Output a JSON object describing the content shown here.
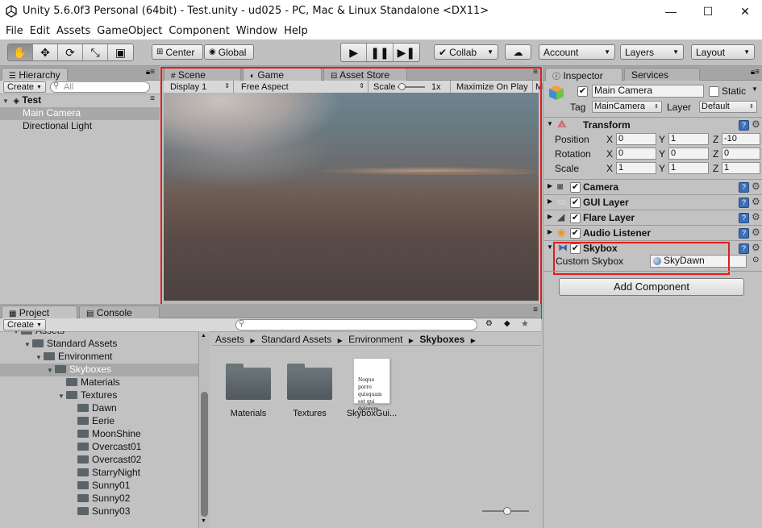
{
  "window": {
    "title": "Unity 5.6.0f3 Personal (64bit) - Test.unity - ud025 - PC, Mac & Linux Standalone <DX11>",
    "minimize": "—",
    "maximize": "☐",
    "close": "✕"
  },
  "menu": [
    "File",
    "Edit",
    "Assets",
    "GameObject",
    "Component",
    "Window",
    "Help"
  ],
  "toolbar": {
    "tools": [
      "hand",
      "move",
      "rotate",
      "scale",
      "rect"
    ],
    "pivot": "Center",
    "space": "Global",
    "collab": "Collab",
    "account": "Account",
    "layers": "Layers",
    "layout": "Layout"
  },
  "hierarchy": {
    "tab": "Hierarchy",
    "create": "Create",
    "search_placeholder": "All",
    "scene": "Test",
    "items": [
      "Main Camera",
      "Directional Light"
    ]
  },
  "center": {
    "tabs": [
      "Scene",
      "Game",
      "Asset Store"
    ],
    "display": "Display 1",
    "aspect": "Free Aspect",
    "scale_label": "Scale",
    "scale_value": "1x",
    "maximize": "Maximize On Play",
    "extra": "M"
  },
  "project": {
    "tabs": [
      "Project",
      "Console"
    ],
    "create": "Create",
    "tree": [
      {
        "label": "Assets",
        "depth": 0,
        "open": true
      },
      {
        "label": "Standard Assets",
        "depth": 1,
        "open": true
      },
      {
        "label": "Environment",
        "depth": 2,
        "open": true
      },
      {
        "label": "Skyboxes",
        "depth": 3,
        "open": true,
        "selected": true
      },
      {
        "label": "Materials",
        "depth": 4
      },
      {
        "label": "Textures",
        "depth": 4,
        "open": true
      },
      {
        "label": "Dawn",
        "depth": 5
      },
      {
        "label": "Eerie",
        "depth": 5
      },
      {
        "label": "MoonShine",
        "depth": 5
      },
      {
        "label": "Overcast01",
        "depth": 5
      },
      {
        "label": "Overcast02",
        "depth": 5
      },
      {
        "label": "StarryNight",
        "depth": 5
      },
      {
        "label": "Sunny01",
        "depth": 5
      },
      {
        "label": "Sunny02",
        "depth": 5
      },
      {
        "label": "Sunny03",
        "depth": 5
      }
    ],
    "breadcrumb": [
      "Assets",
      "Standard Assets",
      "Environment",
      "Skyboxes"
    ],
    "assets": [
      {
        "label": "Materials",
        "type": "folder"
      },
      {
        "label": "Textures",
        "type": "folder"
      },
      {
        "label": "SkyboxGui...",
        "type": "document",
        "preview": "Noquo porro quisquam est qui dolorem."
      }
    ]
  },
  "inspector": {
    "tabs": [
      "Inspector",
      "Services"
    ],
    "object_name": "Main Camera",
    "static_label": "Static",
    "tag_label": "Tag",
    "tag_value": "MainCamera",
    "layer_label": "Layer",
    "layer_value": "Default",
    "transform": {
      "title": "Transform",
      "rows": [
        {
          "label": "Position",
          "x": "0",
          "y": "1",
          "z": "-10"
        },
        {
          "label": "Rotation",
          "x": "0",
          "y": "0",
          "z": "0"
        },
        {
          "label": "Scale",
          "x": "1",
          "y": "1",
          "z": "1"
        }
      ]
    },
    "components": [
      "Camera",
      "GUI Layer",
      "Flare Layer",
      "Audio Listener"
    ],
    "skybox": {
      "title": "Skybox",
      "field_label": "Custom Skybox",
      "field_value": "SkyDawn"
    },
    "add_component": "Add Component"
  },
  "colors": {
    "highlight_box": "#e11d1d",
    "panel": "#c2c2c2",
    "selection": "#a8a8a8"
  }
}
